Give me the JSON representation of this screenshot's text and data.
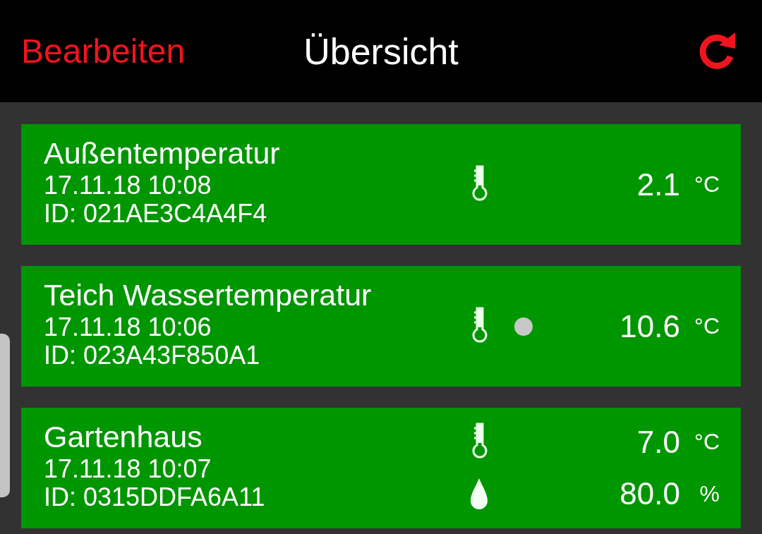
{
  "header": {
    "edit_button": "Bearbeiten",
    "title": "Übersicht"
  },
  "sensors": [
    {
      "name": "Außentemperatur",
      "timestamp": "17.11.18  10:08",
      "id": "ID: 021AE3C4A4F4",
      "indicator": false,
      "readings": [
        {
          "kind": "temperature",
          "value": "2.1",
          "unit": "°C"
        }
      ]
    },
    {
      "name": "Teich Wassertemperatur",
      "timestamp": "17.11.18  10:06",
      "id": "ID: 023A43F850A1",
      "indicator": true,
      "readings": [
        {
          "kind": "temperature",
          "value": "10.6",
          "unit": "°C"
        }
      ]
    },
    {
      "name": "Gartenhaus",
      "timestamp": "17.11.18  10:07",
      "id": "ID: 0315DDFA6A11",
      "indicator": false,
      "readings": [
        {
          "kind": "temperature",
          "value": "7.0",
          "unit": "°C"
        },
        {
          "kind": "humidity",
          "value": "80.0",
          "unit": "%"
        }
      ]
    }
  ]
}
